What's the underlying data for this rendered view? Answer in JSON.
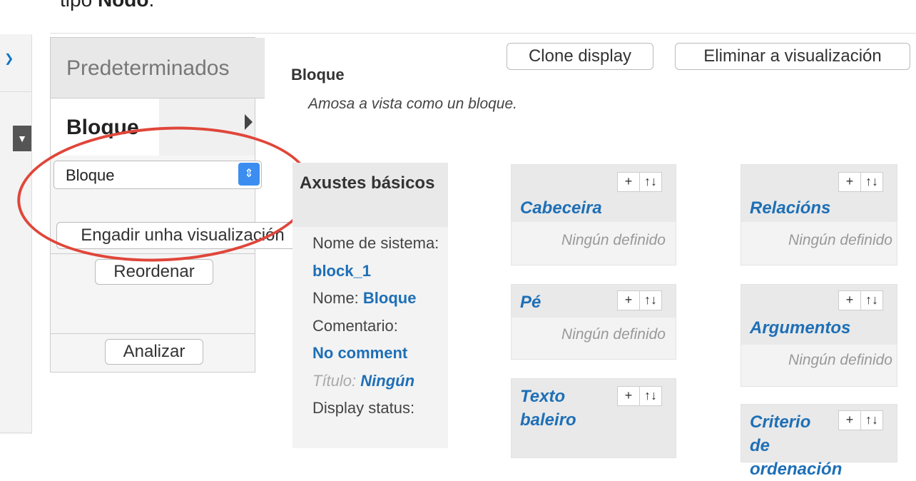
{
  "page": {
    "title_prefix": "tipo",
    "title_strong": "Nodo",
    "title_suffix": "."
  },
  "tabs": {
    "default_label": "Predeterminados",
    "block_label": "Bloque",
    "select_value": "Bloque",
    "add_display_label": "Engadir unha visualización",
    "reorder_label": "Reordenar",
    "analyze_label": "Analizar"
  },
  "toolbar": {
    "clone_label": "Clone display",
    "delete_label": "Eliminar a visualización"
  },
  "display": {
    "title": "Bloque",
    "description": "Amosa a vista como un bloque."
  },
  "basic_settings": {
    "title": "Axustes básicos",
    "machine_name_label": "Nome de sistema:",
    "machine_name_value": "block_1",
    "name_label": "Nome:",
    "name_value": "Bloque",
    "comment_label": "Comentario:",
    "comment_value": "No comment",
    "title_label": "Título:",
    "title_value": "Ningún",
    "status_label": "Display status:"
  },
  "panels": {
    "header": {
      "title": "Cabeceira",
      "empty": "Ningún definido"
    },
    "footer": {
      "title": "Pé",
      "empty": "Ningún definido"
    },
    "no_results": {
      "title": "Texto baleiro"
    },
    "relationships": {
      "title": "Relacións",
      "empty": "Ningún definido"
    },
    "arguments": {
      "title": "Argumentos",
      "empty": "Ningún definido"
    },
    "sort": {
      "title": "Criterio de ordenación"
    }
  },
  "actions": {
    "add": "+",
    "rearrange": "↑↓"
  },
  "icons": {
    "select_spinner": "updown-chevron-icon",
    "tab_arrow": "triangle-right-icon",
    "annotation": "red-ellipse"
  },
  "colors": {
    "accent": "#1e6fb6",
    "annotation": "#e0463a",
    "select": "#3b8ef0"
  }
}
